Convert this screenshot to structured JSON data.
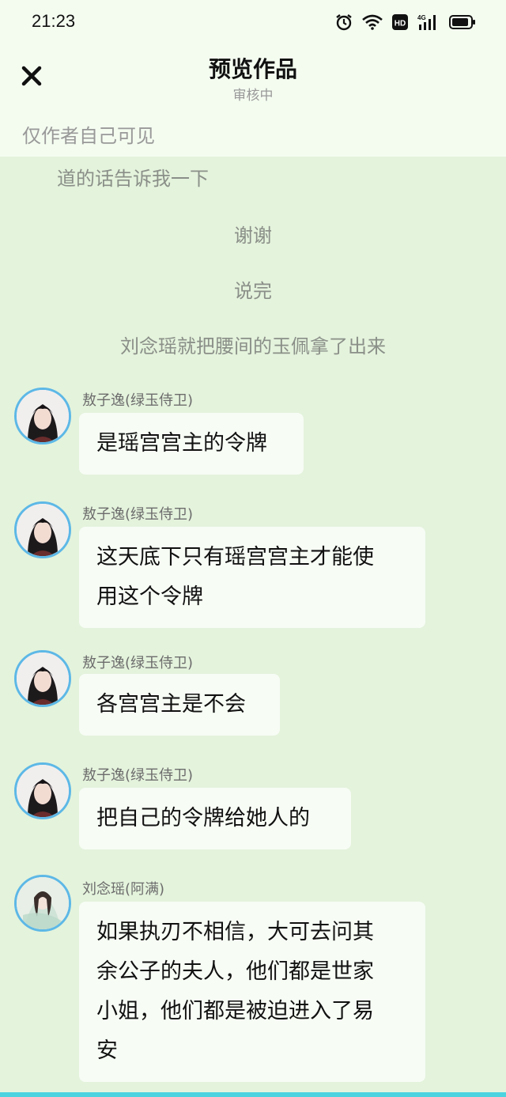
{
  "status_bar": {
    "time": "21:23",
    "icons": [
      "alarm-icon",
      "wifi-icon",
      "hd-icon",
      "signal-4g-icon",
      "battery-icon"
    ]
  },
  "header": {
    "title": "预览作品",
    "subtitle": "审核中",
    "visibility_note": "仅作者自己可见"
  },
  "narration": [
    "道的话告诉我一下",
    "谢谢",
    "说完",
    "刘念瑶就把腰间的玉佩拿了出来"
  ],
  "messages": [
    {
      "sender": "敖子逸(绿玉侍卫)",
      "lines": [
        "是瑶宫宫主的令牌"
      ]
    },
    {
      "sender": "敖子逸(绿玉侍卫)",
      "lines": [
        "这天底下只有瑶宫宫主才能使",
        "用这个令牌"
      ]
    },
    {
      "sender": "敖子逸(绿玉侍卫)",
      "lines": [
        "各宫宫主是不会"
      ]
    },
    {
      "sender": "敖子逸(绿玉侍卫)",
      "lines": [
        "把自己的令牌给她人的"
      ]
    },
    {
      "sender": "刘念瑶(阿满)",
      "lines": [
        "如果执刃不相信，大可去问其",
        "余公子的夫人，他们都是世家",
        "小姐，他们都是被迫进入了易",
        "安"
      ]
    }
  ],
  "colors": {
    "background": "#e4f3dc",
    "header_bg": "#f4fcf0",
    "bubble_bg": "#f7fcf5",
    "avatar_border": "#5db8e6"
  }
}
